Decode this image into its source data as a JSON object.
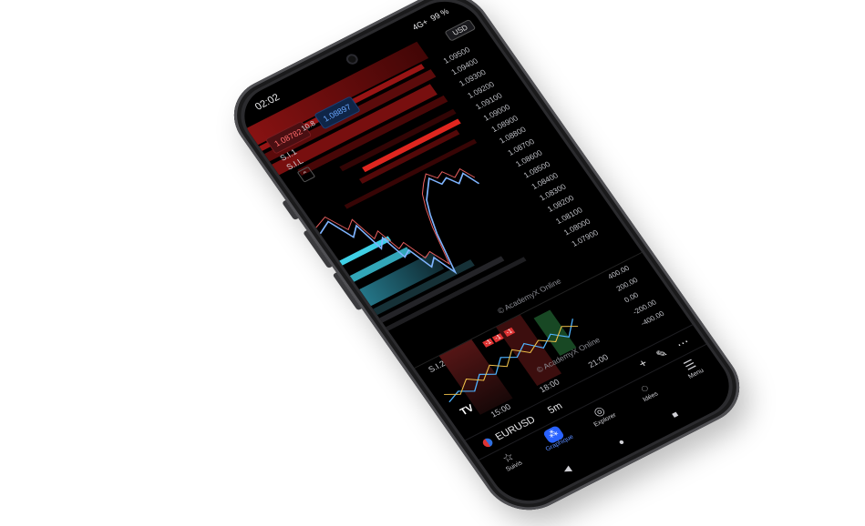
{
  "status_bar": {
    "time": "02:02",
    "signal": "4G+",
    "battery": "99 %"
  },
  "chart": {
    "currency": "USD",
    "sell_price": "1.08782",
    "spread": "10.8",
    "buy_price": "1.08897",
    "indicator_1": "S.I.1",
    "indicator_2": "S.I.L",
    "collapse_icon": "chevron-up-icon",
    "price_labels": [
      "1.09500",
      "1.09400",
      "1.09300",
      "1.09200",
      "1.09100",
      "1.09000",
      "1.08900",
      "1.08800",
      "1.08700",
      "1.08600",
      "1.08500",
      "1.08400",
      "1.08300",
      "1.08200",
      "1.08100",
      "1.08000",
      "1.07900"
    ],
    "watermark": "© AcademyX Online",
    "colors": {
      "red": "#e0261f",
      "cyan": "#3fd0e6",
      "price_line": "#7fb4ff"
    }
  },
  "oscillator": {
    "label": "S.I.2",
    "scale": [
      "400.00",
      "200.00",
      "0.00",
      "-200.00",
      "-400.00"
    ],
    "marker_1": "-1",
    "marker_2": "-1",
    "marker_3": "-1",
    "watermark": "© AcademyX Online"
  },
  "time_axis": [
    "15:00",
    "18:00",
    "21:00"
  ],
  "toolbar": {
    "symbol": "EURUSD",
    "interval": "5m",
    "add_icon": "plus-icon",
    "draw_icon": "pencil-icon",
    "more_icon": "more-icon"
  },
  "nav": {
    "items": [
      {
        "label": "Suivis",
        "icon": "star-icon",
        "glyph": "☆"
      },
      {
        "label": "Graphique",
        "icon": "chart-icon",
        "glyph": "⁂"
      },
      {
        "label": "Explorer",
        "icon": "compass-icon",
        "glyph": "◎"
      },
      {
        "label": "Idées",
        "icon": "bulb-icon",
        "glyph": "◌"
      },
      {
        "label": "Menu",
        "icon": "menu-icon",
        "glyph": "☰"
      }
    ]
  },
  "system_nav": {
    "back": "◀",
    "home": "●",
    "recents": "■"
  }
}
